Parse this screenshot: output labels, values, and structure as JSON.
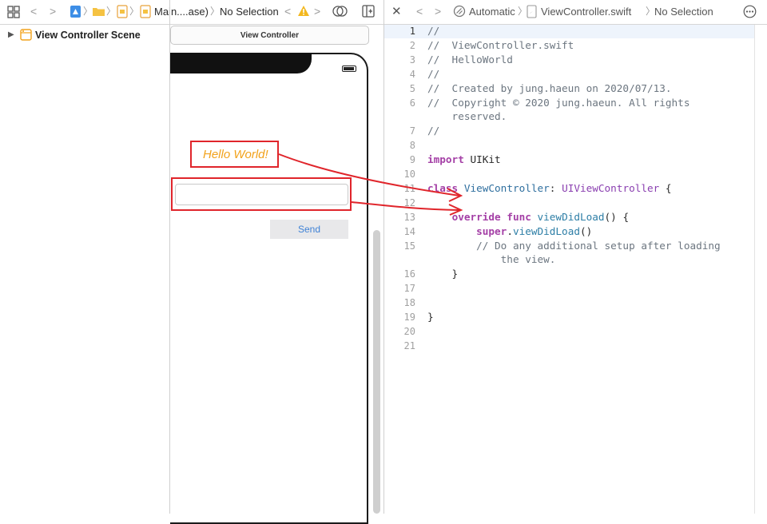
{
  "left_jump_bar": {
    "crumb_main": "Main....ase)",
    "crumb_selection": "No Selection"
  },
  "right_jump_bar": {
    "mode": "Automatic",
    "file": "ViewController.swift",
    "selection": "No Selection"
  },
  "outline": {
    "scene": "View Controller Scene"
  },
  "canvas": {
    "scene_title": "View Controller",
    "label_text": "Hello World!",
    "button_label": "Send"
  },
  "code": {
    "lines": [
      {
        "n": "1",
        "parts": [
          {
            "c": "cm",
            "t": "//"
          }
        ]
      },
      {
        "n": "2",
        "parts": [
          {
            "c": "cm",
            "t": "//  ViewController.swift"
          }
        ]
      },
      {
        "n": "3",
        "parts": [
          {
            "c": "cm",
            "t": "//  HelloWorld"
          }
        ]
      },
      {
        "n": "4",
        "parts": [
          {
            "c": "cm",
            "t": "//"
          }
        ]
      },
      {
        "n": "5",
        "parts": [
          {
            "c": "cm",
            "t": "//  Created by jung.haeun on 2020/07/13."
          }
        ]
      },
      {
        "n": "6",
        "parts": [
          {
            "c": "cm",
            "t": "//  Copyright © 2020 jung.haeun. All rights"
          }
        ]
      },
      {
        "n": "",
        "parts": [
          {
            "c": "cm",
            "t": "    reserved."
          }
        ]
      },
      {
        "n": "7",
        "parts": [
          {
            "c": "cm",
            "t": "//"
          }
        ]
      },
      {
        "n": "8",
        "parts": []
      },
      {
        "n": "9",
        "parts": [
          {
            "c": "kw",
            "t": "import"
          },
          {
            "c": "",
            "t": " UIKit"
          }
        ]
      },
      {
        "n": "10",
        "parts": []
      },
      {
        "n": "11",
        "parts": [
          {
            "c": "kw",
            "t": "class"
          },
          {
            "c": "",
            "t": " "
          },
          {
            "c": "ty",
            "t": "ViewController"
          },
          {
            "c": "",
            "t": ": "
          },
          {
            "c": "kw-type",
            "t": "UIViewController"
          },
          {
            "c": "",
            "t": " {"
          }
        ]
      },
      {
        "n": "12",
        "parts": []
      },
      {
        "n": "13",
        "parts": [
          {
            "c": "",
            "t": "    "
          },
          {
            "c": "kw",
            "t": "override"
          },
          {
            "c": "",
            "t": " "
          },
          {
            "c": "kw",
            "t": "func"
          },
          {
            "c": "",
            "t": " "
          },
          {
            "c": "fn",
            "t": "viewDidLoad"
          },
          {
            "c": "",
            "t": "() {"
          }
        ]
      },
      {
        "n": "14",
        "parts": [
          {
            "c": "",
            "t": "        "
          },
          {
            "c": "kw",
            "t": "super"
          },
          {
            "c": "",
            "t": "."
          },
          {
            "c": "fn",
            "t": "viewDidLoad"
          },
          {
            "c": "",
            "t": "()"
          }
        ]
      },
      {
        "n": "15",
        "parts": [
          {
            "c": "cm",
            "t": "        // Do any additional setup after loading"
          }
        ]
      },
      {
        "n": "",
        "parts": [
          {
            "c": "cm",
            "t": "            the view."
          }
        ]
      },
      {
        "n": "16",
        "parts": [
          {
            "c": "",
            "t": "    }"
          }
        ]
      },
      {
        "n": "17",
        "parts": []
      },
      {
        "n": "18",
        "parts": []
      },
      {
        "n": "19",
        "parts": [
          {
            "c": "",
            "t": "}"
          }
        ]
      },
      {
        "n": "20",
        "parts": []
      },
      {
        "n": "21",
        "parts": []
      }
    ]
  },
  "colors": {
    "annotation_red": "#e0252b",
    "label_orange": "#f2a21b",
    "button_blue": "#3f82d6",
    "keyword_purple": "#a43fa6",
    "type_purple": "#8a3fb0"
  }
}
